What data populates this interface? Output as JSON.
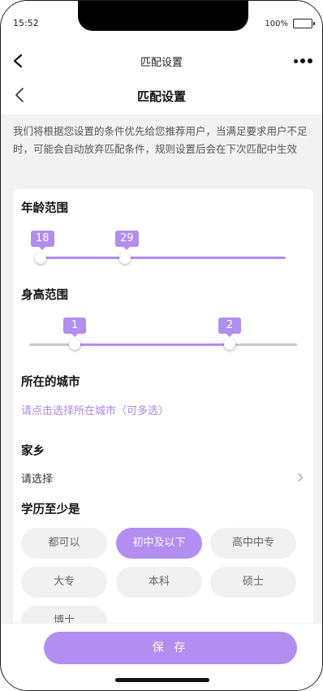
{
  "status_bar": {
    "time": "15:52",
    "battery": "100%"
  },
  "mini_nav": {
    "title": "匹配设置"
  },
  "header": {
    "title": "匹配设置"
  },
  "notice": "我们将根据您设置的条件优先给您推荐用户，当满足要求用户不足时，可能会自动放弃匹配条件，规则设置后会在下次匹配中生效",
  "age": {
    "title": "年龄范围",
    "min": "18",
    "max": "29"
  },
  "height": {
    "title": "身高范围",
    "min": "1",
    "max": "2"
  },
  "city": {
    "title": "所在的城市",
    "placeholder": "请点击选择所在城市（可多选）"
  },
  "hometown": {
    "title": "家乡",
    "value": "请选择"
  },
  "education": {
    "title": "学历至少是",
    "options": [
      "都可以",
      "初中及以下",
      "高中中专",
      "大专",
      "本科",
      "硕士",
      "博士"
    ],
    "selected": "初中及以下"
  },
  "save_label": "保 存",
  "colors": {
    "accent": "#b18ef0",
    "track": "#c8c8cc",
    "background": "#f2f2f2"
  },
  "icons": {
    "back": "chevron-left-icon",
    "more": "more-dots-icon",
    "hometown_arrow": "chevron-right-icon"
  }
}
